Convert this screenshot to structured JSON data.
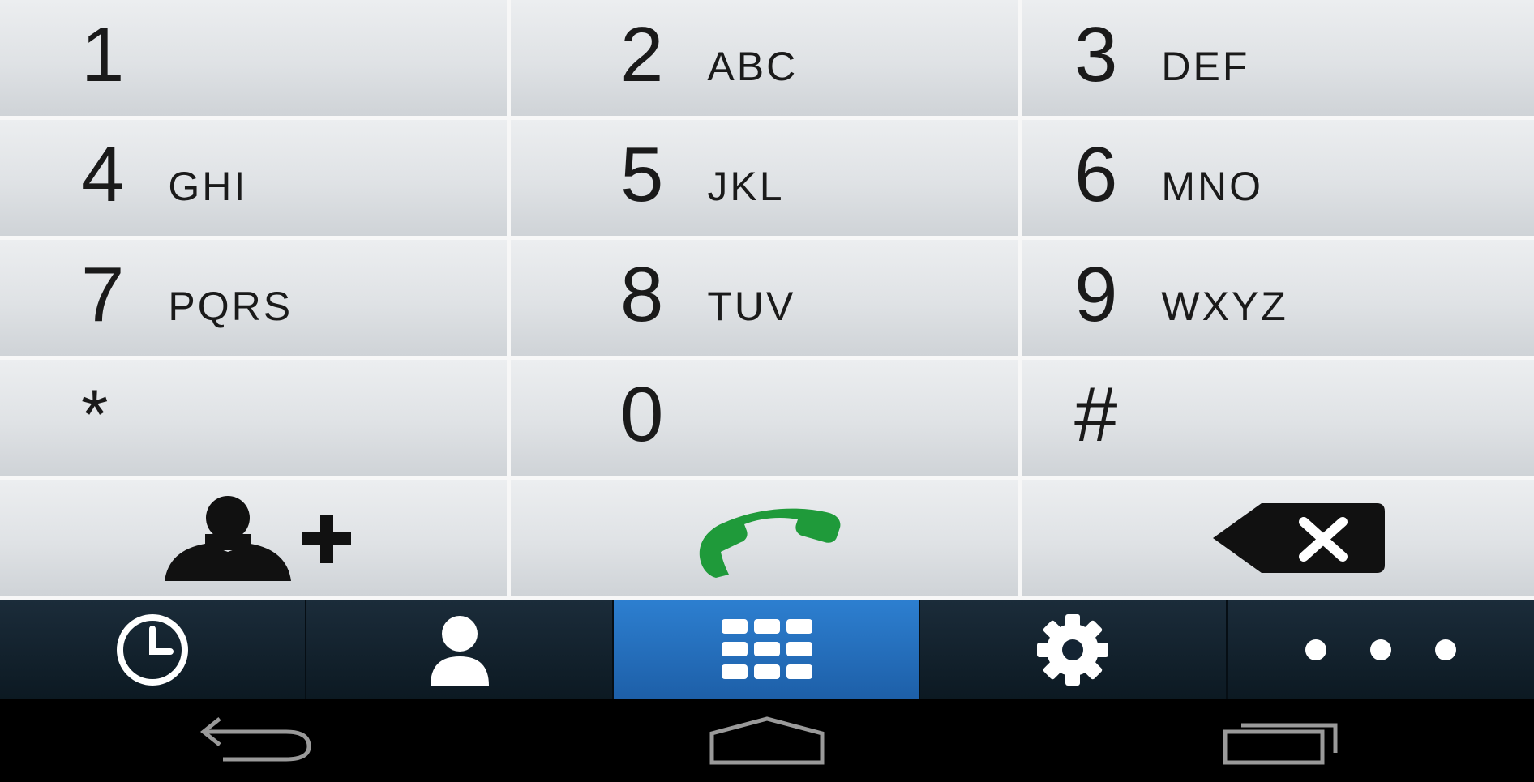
{
  "keypad": {
    "keys": [
      {
        "digit": "1",
        "letters": ""
      },
      {
        "digit": "2",
        "letters": "ABC"
      },
      {
        "digit": "3",
        "letters": "DEF"
      },
      {
        "digit": "4",
        "letters": "GHI"
      },
      {
        "digit": "5",
        "letters": "JKL"
      },
      {
        "digit": "6",
        "letters": "MNO"
      },
      {
        "digit": "7",
        "letters": "PQRS"
      },
      {
        "digit": "8",
        "letters": "TUV"
      },
      {
        "digit": "9",
        "letters": "WXYZ"
      },
      {
        "digit": "*",
        "letters": ""
      },
      {
        "digit": "0",
        "letters": ""
      },
      {
        "digit": "#",
        "letters": ""
      }
    ],
    "actions": {
      "add_contact_icon": "person-add-icon",
      "call_icon": "phone-handset-icon",
      "backspace_icon": "backspace-icon"
    }
  },
  "tabbar": {
    "tabs": [
      {
        "icon": "clock-icon",
        "active": false
      },
      {
        "icon": "person-icon",
        "active": false
      },
      {
        "icon": "dialpad-icon",
        "active": true
      },
      {
        "icon": "gear-icon",
        "active": false
      },
      {
        "icon": "more-dots-icon",
        "active": false
      }
    ]
  },
  "navbar": {
    "buttons": [
      {
        "icon": "back-arrow-icon"
      },
      {
        "icon": "home-icon"
      },
      {
        "icon": "recent-apps-icon"
      }
    ]
  },
  "colors": {
    "call_green": "#1f9a3a",
    "tab_active": "#2d7fd0",
    "tabbar_bg": "#142433",
    "key_bg": "#dfe2e5"
  }
}
